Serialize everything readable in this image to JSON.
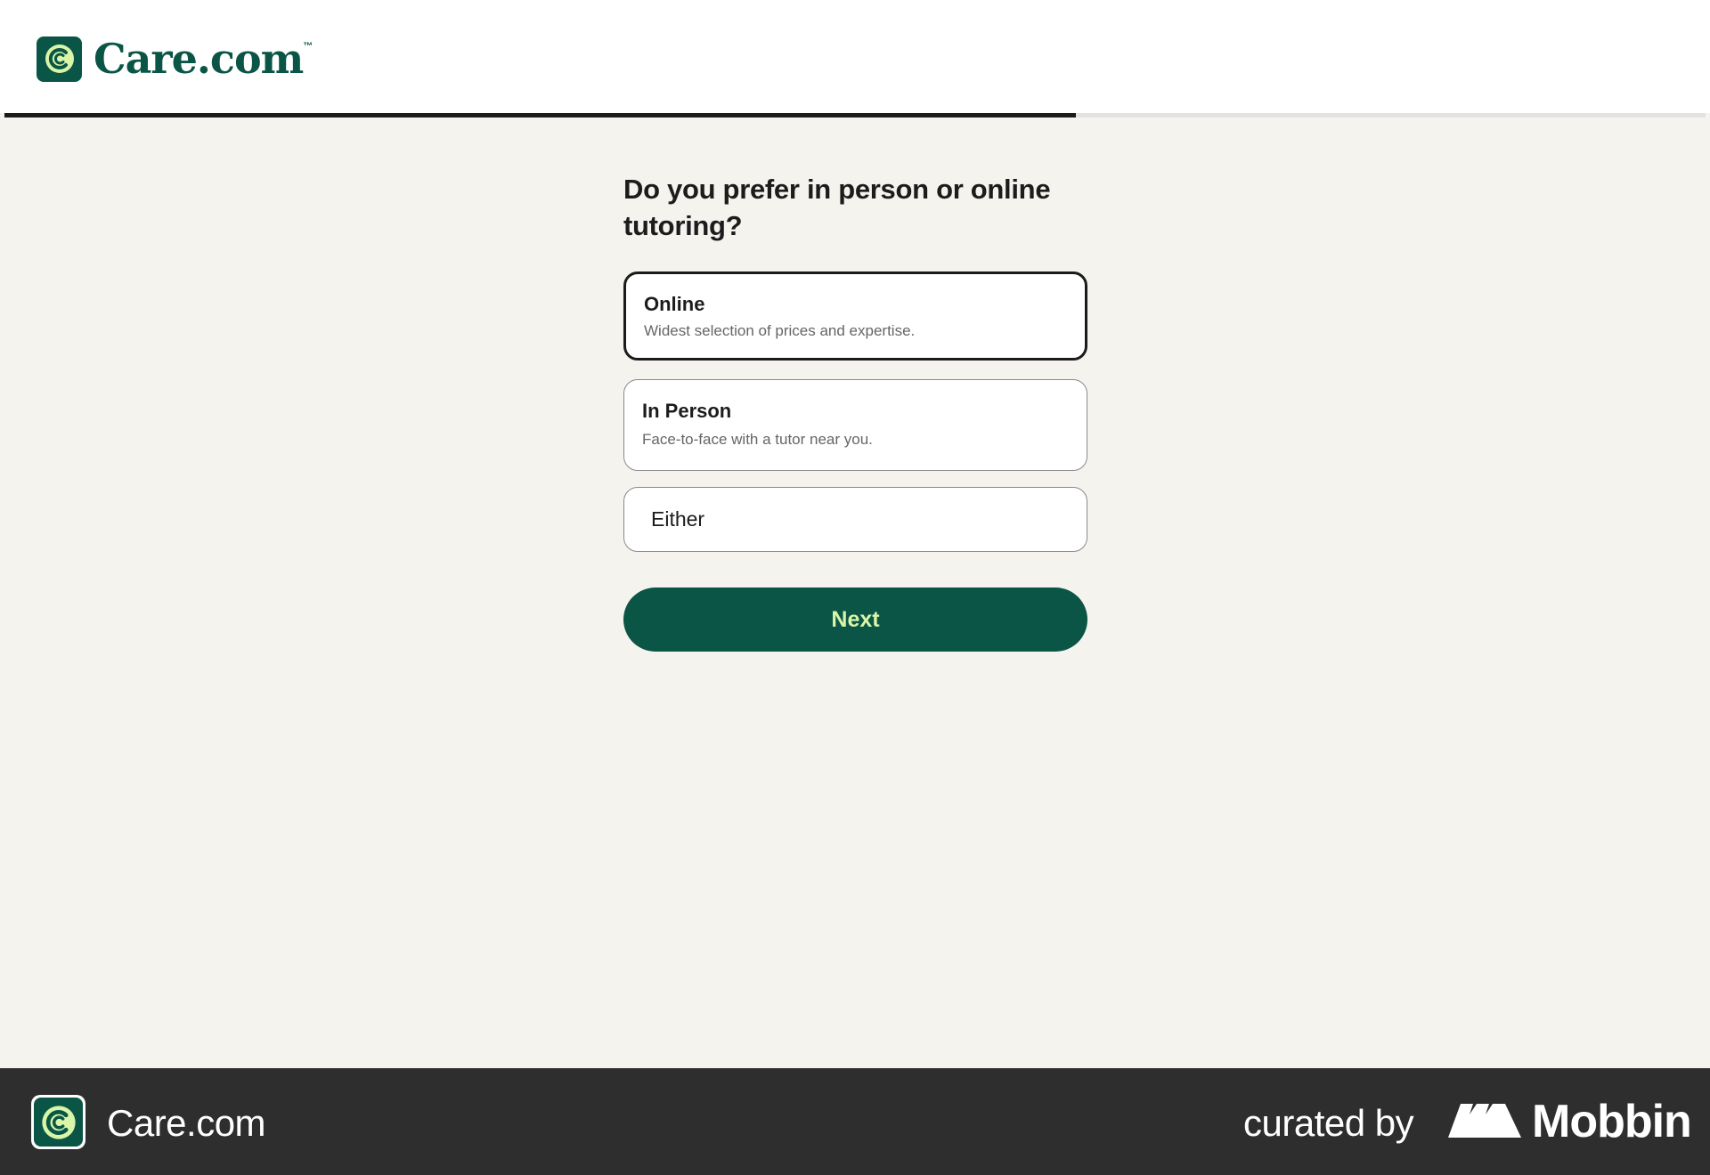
{
  "brand": {
    "name": "Care.com",
    "trademark": "™",
    "color": "#0a5546",
    "accent": "#d8f5a8"
  },
  "progress": {
    "fraction": 0.63
  },
  "question": "Do you prefer in person or online tutoring?",
  "options": [
    {
      "title": "Online",
      "description": "Widest selection of prices and expertise.",
      "selected": true
    },
    {
      "title": "In Person",
      "description": "Face-to-face with a tutor near you.",
      "selected": false
    },
    {
      "title": "Either",
      "selected": false
    }
  ],
  "next_label": "Next",
  "footer": {
    "app_name": "Care.com",
    "curated_by": "curated by",
    "mobbin": "Mobbin"
  }
}
